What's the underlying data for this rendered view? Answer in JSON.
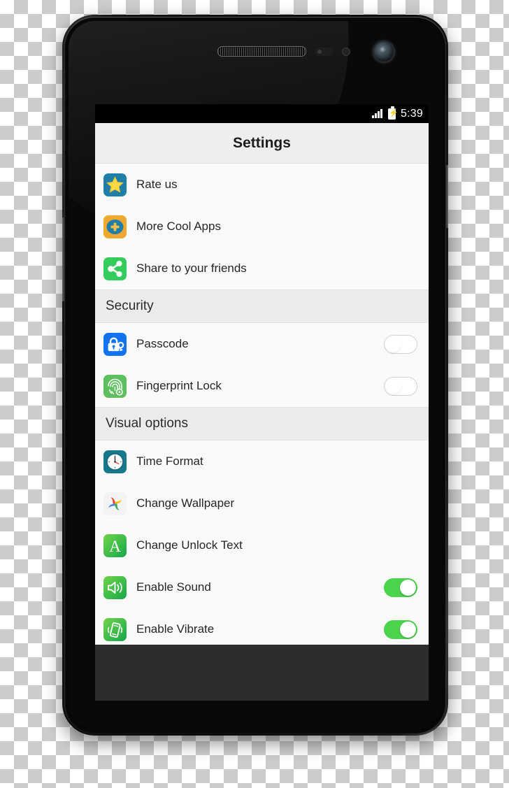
{
  "device": {
    "type": "smartphone",
    "components": [
      "earpiece-speaker",
      "proximity-sensor",
      "light-sensor",
      "front-camera",
      "volume-button",
      "power-button"
    ]
  },
  "status_bar": {
    "time": "5:39",
    "signal_icon": "signal-bars-icon",
    "battery_icon": "battery-charging-icon",
    "battery_bolt": "⚡",
    "background": "#000000"
  },
  "header": {
    "title": "Settings",
    "background": "#eeeeee"
  },
  "sections": [
    {
      "id": "general",
      "header": null,
      "rows": [
        {
          "id": "rate-us",
          "label": "Rate us",
          "icon": "star-icon",
          "icon_class": "ic-star",
          "toggle": null
        },
        {
          "id": "more-cool-apps",
          "label": "More Cool Apps",
          "icon": "plus-circle-icon",
          "icon_class": "ic-plus",
          "toggle": null
        },
        {
          "id": "share",
          "label": "Share to your friends",
          "icon": "share-icon",
          "icon_class": "ic-share",
          "toggle": null
        }
      ]
    },
    {
      "id": "security",
      "header": "Security",
      "rows": [
        {
          "id": "passcode",
          "label": "Passcode",
          "icon": "lock-key-icon",
          "icon_class": "ic-passcode",
          "toggle": "off"
        },
        {
          "id": "fingerprint-lock",
          "label": "Fingerprint Lock",
          "icon": "fingerprint-icon",
          "icon_class": "ic-finger",
          "toggle": "off"
        }
      ]
    },
    {
      "id": "visual-options",
      "header": "Visual options",
      "rows": [
        {
          "id": "time-format",
          "label": "Time Format",
          "icon": "clock-icon",
          "icon_class": "ic-clock",
          "toggle": null
        },
        {
          "id": "change-wallpaper",
          "label": "Change Wallpaper",
          "icon": "photos-pinwheel-icon",
          "icon_class": "ic-wallpaper",
          "toggle": null
        },
        {
          "id": "change-unlock-text",
          "label": "Change Unlock Text",
          "icon": "letter-a-icon",
          "icon_class": "ic-unlocktext",
          "toggle": null
        },
        {
          "id": "enable-sound",
          "label": "Enable Sound",
          "icon": "speaker-icon",
          "icon_class": "ic-sound",
          "toggle": "on"
        },
        {
          "id": "enable-vibrate",
          "label": "Enable Vibrate",
          "icon": "vibrate-phone-icon",
          "icon_class": "ic-vibrate",
          "toggle": "on"
        }
      ]
    }
  ],
  "colors": {
    "toggle_on": "#4cd34c",
    "toggle_off_border": "#d2d2d2",
    "section_header_bg": "#ebebeb",
    "list_bg": "#fafafa",
    "system_bottom_bg": "#2d2d2d"
  }
}
